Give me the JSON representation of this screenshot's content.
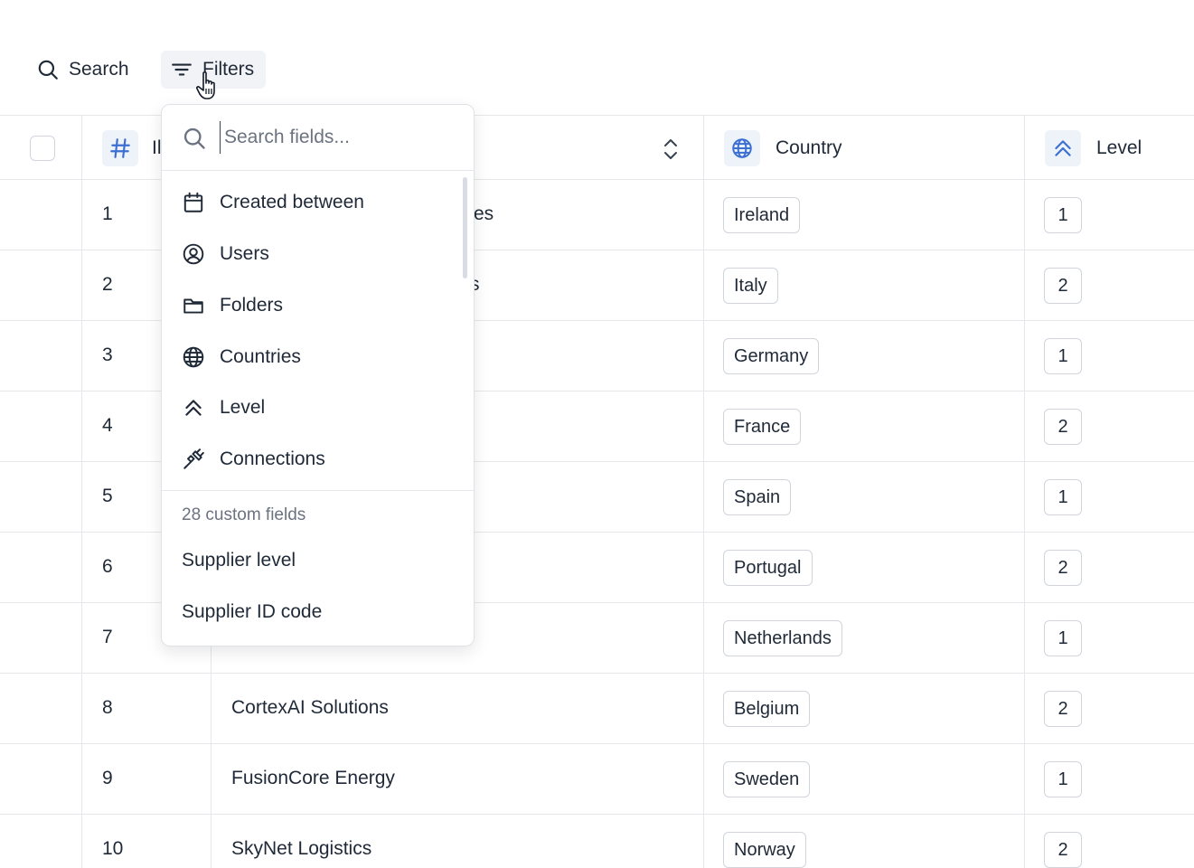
{
  "toolbar": {
    "search_label": "Search",
    "filters_label": "Filters"
  },
  "table": {
    "headers": {
      "id_label": "Il",
      "country_label": "Country",
      "level_label": "Level"
    },
    "rows": [
      {
        "id": "1",
        "name": "es",
        "country": "Ireland",
        "level": "1"
      },
      {
        "id": "2",
        "name": "s",
        "country": "Italy",
        "level": "2"
      },
      {
        "id": "3",
        "name": "",
        "country": "Germany",
        "level": "1"
      },
      {
        "id": "4",
        "name": "",
        "country": "France",
        "level": "2"
      },
      {
        "id": "5",
        "name": "",
        "country": "Spain",
        "level": "1"
      },
      {
        "id": "6",
        "name": "",
        "country": "Portugal",
        "level": "2"
      },
      {
        "id": "7",
        "name": "",
        "country": "Netherlands",
        "level": "1"
      },
      {
        "id": "8",
        "name": "CortexAI Solutions",
        "country": "Belgium",
        "level": "2"
      },
      {
        "id": "9",
        "name": "FusionCore Energy",
        "country": "Sweden",
        "level": "1"
      },
      {
        "id": "10",
        "name": "SkyNet Logistics",
        "country": "Norway",
        "level": "2"
      }
    ]
  },
  "dropdown": {
    "search_placeholder": "Search fields...",
    "items": [
      {
        "label": "Created between",
        "icon": "calendar-icon"
      },
      {
        "label": "Users",
        "icon": "user-circle-icon"
      },
      {
        "label": "Folders",
        "icon": "folder-icon"
      },
      {
        "label": "Countries",
        "icon": "globe-icon"
      },
      {
        "label": "Level",
        "icon": "double-chevron-up-icon"
      },
      {
        "label": "Connections",
        "icon": "plug-icon"
      }
    ],
    "section_label": "28 custom fields",
    "custom_items": [
      "Supplier level",
      "Supplier ID code"
    ]
  },
  "colors": {
    "accent": "#3b6fd1",
    "border": "#e5e7eb",
    "text": "#1f2937",
    "muted": "#6b7280"
  }
}
